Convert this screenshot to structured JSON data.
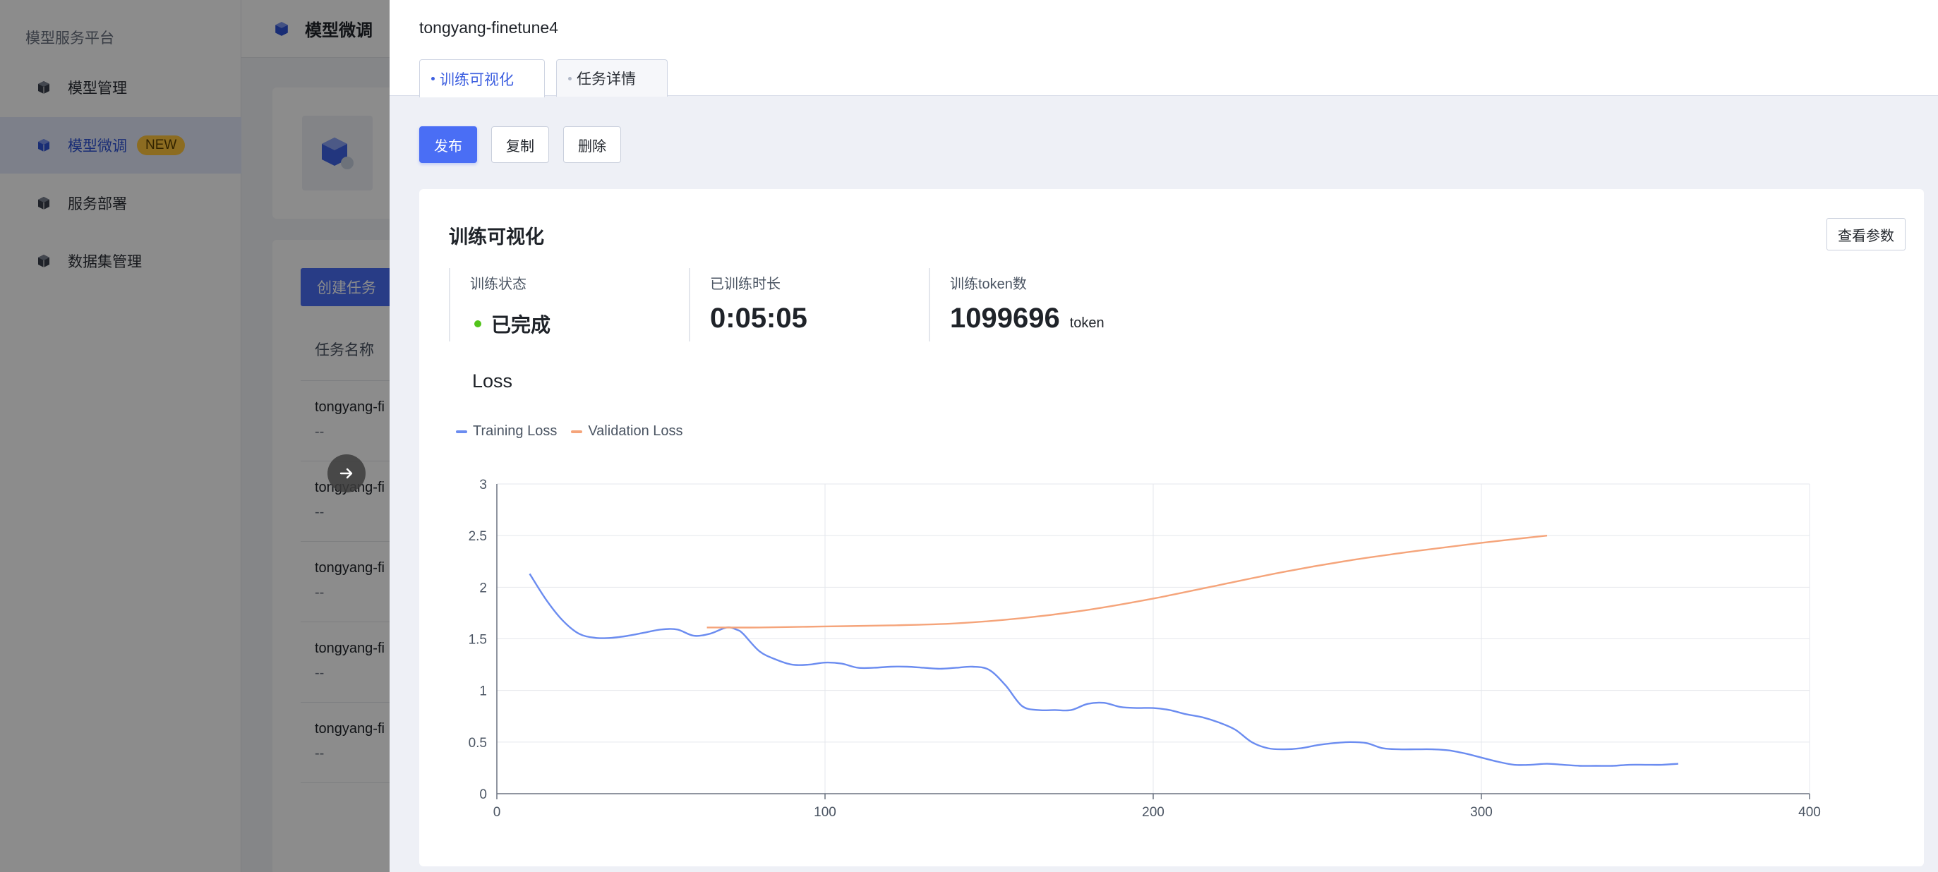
{
  "sidebar": {
    "title": "模型服务平台",
    "items": [
      {
        "label": "模型管理",
        "icon": "cube-icon"
      },
      {
        "label": "模型微调",
        "icon": "cube-icon",
        "badge": "NEW"
      },
      {
        "label": "服务部署",
        "icon": "cube-icon"
      },
      {
        "label": "数据集管理",
        "icon": "cube-icon"
      }
    ]
  },
  "page": {
    "title": "模型微调",
    "create_button": "创建任务",
    "table_header": "任务名称",
    "rows": [
      {
        "name": "tongyang-fi",
        "sub": "--"
      },
      {
        "name": "tongyang-fi",
        "sub": "--"
      },
      {
        "name": "tongyang-fi",
        "sub": "--"
      },
      {
        "name": "tongyang-fi",
        "sub": "--"
      },
      {
        "name": "tongyang-fi",
        "sub": "--"
      }
    ]
  },
  "drawer": {
    "title": "tongyang-finetune4",
    "tabs": [
      "训练可视化",
      "任务详情"
    ],
    "actions": {
      "publish": "发布",
      "copy": "复制",
      "delete": "删除"
    },
    "panel_title": "训练可视化",
    "view_params": "查看参数",
    "stats": [
      {
        "label": "训练状态",
        "value": "已完成"
      },
      {
        "label": "已训练时长",
        "value": "0:05:05"
      },
      {
        "label": "训练token数",
        "value": "1099696",
        "unit": "token"
      }
    ],
    "colors": {
      "status_ok": "#52c41a",
      "accent": "#4a6ef5"
    }
  },
  "chart_data": {
    "type": "line",
    "title": "Loss",
    "xlabel": "",
    "ylabel": "",
    "xlim": [
      0,
      400
    ],
    "ylim": [
      0,
      3
    ],
    "x_ticks": [
      0,
      100,
      200,
      300,
      400
    ],
    "y_ticks": [
      0,
      0.5,
      1,
      1.5,
      2,
      2.5,
      3
    ],
    "grid": true,
    "legend_position": "top-left",
    "series": [
      {
        "name": "Training Loss",
        "color": "#6b8cf0",
        "x": [
          10,
          15,
          20,
          25,
          30,
          35,
          40,
          45,
          50,
          55,
          60,
          65,
          70,
          73,
          75,
          80,
          85,
          90,
          95,
          100,
          105,
          110,
          115,
          120,
          125,
          130,
          135,
          140,
          145,
          150,
          155,
          160,
          165,
          170,
          175,
          180,
          185,
          190,
          195,
          200,
          205,
          210,
          215,
          220,
          225,
          230,
          235,
          240,
          245,
          250,
          255,
          260,
          265,
          270,
          275,
          280,
          285,
          290,
          295,
          300,
          305,
          310,
          315,
          320,
          325,
          330,
          335,
          340,
          345,
          350,
          355,
          360
        ],
        "y": [
          2.13,
          1.88,
          1.68,
          1.55,
          1.51,
          1.51,
          1.53,
          1.56,
          1.59,
          1.59,
          1.53,
          1.55,
          1.61,
          1.59,
          1.55,
          1.38,
          1.3,
          1.25,
          1.25,
          1.27,
          1.26,
          1.22,
          1.22,
          1.23,
          1.23,
          1.22,
          1.21,
          1.22,
          1.23,
          1.2,
          1.05,
          0.85,
          0.81,
          0.81,
          0.81,
          0.87,
          0.88,
          0.84,
          0.83,
          0.83,
          0.81,
          0.77,
          0.74,
          0.69,
          0.62,
          0.5,
          0.44,
          0.43,
          0.44,
          0.47,
          0.49,
          0.5,
          0.49,
          0.44,
          0.43,
          0.43,
          0.43,
          0.42,
          0.39,
          0.35,
          0.31,
          0.28,
          0.28,
          0.29,
          0.28,
          0.27,
          0.27,
          0.27,
          0.28,
          0.28,
          0.28,
          0.29
        ]
      },
      {
        "name": "Validation Loss",
        "color": "#f5a47a",
        "x": [
          64,
          80,
          100,
          120,
          140,
          160,
          180,
          200,
          220,
          240,
          260,
          280,
          300,
          320
        ],
        "y": [
          1.61,
          1.61,
          1.62,
          1.63,
          1.65,
          1.7,
          1.78,
          1.89,
          2.02,
          2.15,
          2.26,
          2.35,
          2.43,
          2.5
        ]
      }
    ]
  }
}
